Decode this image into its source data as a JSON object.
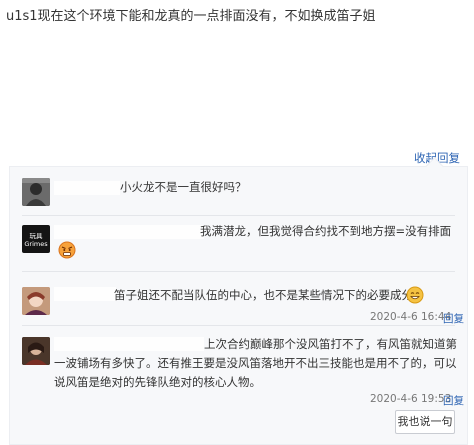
{
  "post": {
    "text": "u1s1现在这个环境下能和龙真的一点排面没有，不如换成笛子姐"
  },
  "collapse_label": "收起回复",
  "replies": [
    {
      "text": "小火龙不是一直很好吗？",
      "avatar_icon": "dark-avatar-icon"
    },
    {
      "text": "我满潜龙，但我觉得合约找不到地方摆=没有排面",
      "avatar_text": "玩具 Grimes",
      "emoji": "angry-face-emoji"
    },
    {
      "text": "笛子姐还不配当队伍的中心，也不是某些情况下的必要成分",
      "emoji": "grin-face-emoji",
      "time": "2020-4-6 16:44",
      "reply_label": "回复"
    },
    {
      "text": "上次合约巅峰那个没风笛打不了，有风笛就知道第一波铺场有多快了。还有推王要是没风笛落地开不出三技能也是用不了的，可以说风笛是绝对的先锋队绝对的核心人物。",
      "time": "2020-4-6 19:53",
      "reply_label": "回复"
    }
  ],
  "say_button_label": "我也说一句"
}
